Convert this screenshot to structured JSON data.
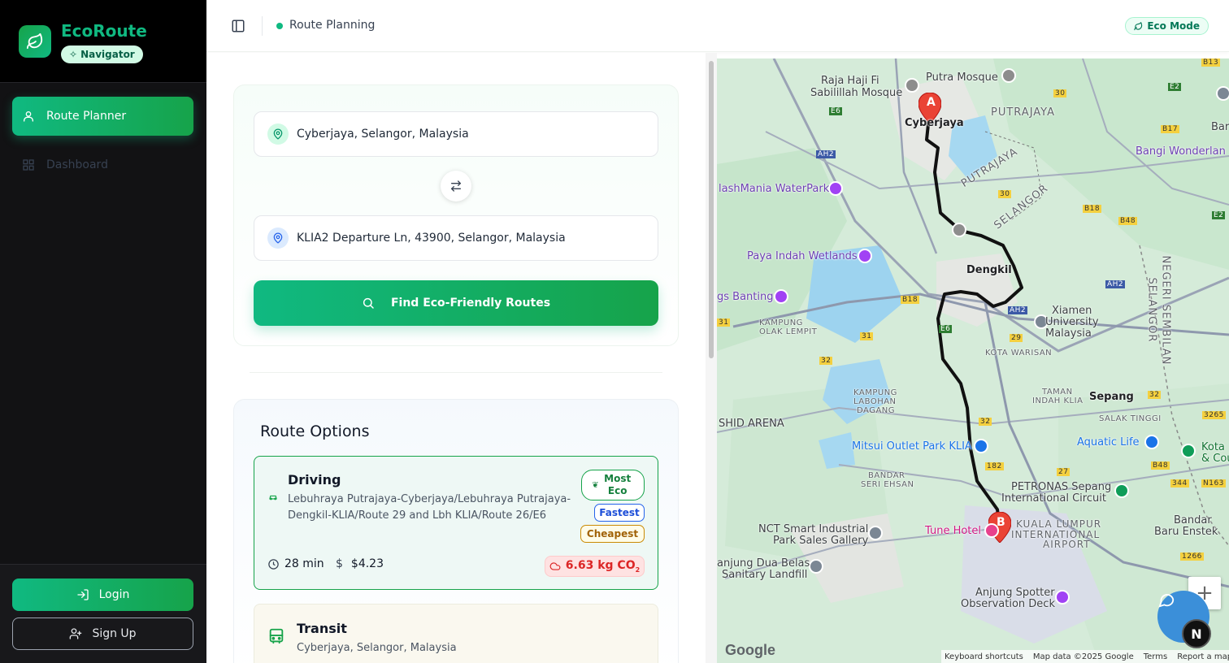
{
  "sidebar": {
    "brand_title": "EcoRoute",
    "brand_badge": "Navigator",
    "nav": [
      {
        "label": "Route Planner",
        "icon": "user-pin-icon",
        "active": true
      },
      {
        "label": "Dashboard",
        "icon": "grid-icon",
        "active": false
      }
    ],
    "login_label": "Login",
    "signup_label": "Sign Up"
  },
  "topbar": {
    "page_label": "Route Planning",
    "eco_mode_label": "Eco Mode"
  },
  "search": {
    "origin": "Cyberjaya, Selangor, Malaysia",
    "destination": "KLIA2 Departure Ln, 43900, Selangor, Malaysia",
    "find_label": "Find Eco-Friendly Routes"
  },
  "routes": {
    "title": "Route Options",
    "items": [
      {
        "mode": "Driving",
        "description": "Lebuhraya Putrajaya-Cyberjaya/Lebuhraya Putrajaya-Dengkil-KLIA/Route 29 and Lbh KLIA/Route 26/E6",
        "tags": [
          "Most Eco",
          "Fastest",
          "Cheapest"
        ],
        "duration": "28 min",
        "cost": "$4.23",
        "co2": "6.63 kg CO",
        "co2_sub": "2"
      },
      {
        "mode": "Transit",
        "description": "Cyberjaya, Selangor, Malaysia"
      }
    ]
  },
  "map": {
    "labels": {
      "raja_haji": "Raja Haji Fi",
      "sabilillah": "Sabilillah Mosque",
      "putra_mosque": "Putra Mosque",
      "cyberjaya": "Cyberjaya",
      "putrajaya": "PUTRAJAYA",
      "putrajaya_area": "PUTRAJAYA",
      "selangor_area": "SELANGOR",
      "bangi": "Bangi Wonderlan",
      "bar": "Bar",
      "splash": "lashMania WaterPark",
      "paya": "Paya Indah Wetlands",
      "dengkil": "Dengkil",
      "banting": "gs Banting",
      "kampung_olak_1": "KAMPUNG",
      "kampung_olak_2": "OLAK LEMPIT",
      "xiamen_1": "Xiamen",
      "xiamen_2": "University",
      "xiamen_3": "Malaysia",
      "kota_warisan": "KOTA WARISAN",
      "negeri_1": "NEGERI SEMBILAN",
      "negeri_2": "SELANGOR",
      "kampung_labohan_1": "KAMPUNG",
      "kampung_labohan_2": "LABOHAN",
      "kampung_labohan_3": "DAGANG",
      "taman_1": "TAMAN",
      "taman_2": "INDAH KLIA",
      "sepang": "Sepang",
      "salak": "SALAK TINGGI",
      "arena": "SHID ARENA",
      "mitsui": "Mitsui Outlet Park KLIA",
      "aquatic": "Aquatic Life",
      "kota_1": "Kota",
      "kota_2": "& Cou",
      "bandar_seri_1": "BANDAR",
      "bandar_seri_2": "SERI EHSAN",
      "petronas_1": "PETRONAS Sepang",
      "petronas_2": "International Circuit",
      "nct_1": "NCT Smart Industrial",
      "nct_2": "Park Sales Gallery",
      "tune": "Tune Hotel",
      "klia_1": "KUALA LUMPUR",
      "klia_2": "INTERNATIONAL",
      "klia_3": "AIRPORT",
      "bandar_baru_1": "Bandar",
      "bandar_baru_2": "Baru Enstek",
      "tanjung_1": "anjung Dua Belas",
      "tanjung_2": "Sanitary Landfill",
      "anjung_1": "Anjung Spotter",
      "anjung_2": "Observation Deck",
      "marker_a": "A",
      "marker_b": "B",
      "shields": {
        "b13": "B13",
        "e2a": "E2",
        "e6": "E6",
        "ah2a": "AH2",
        "n30a": "30",
        "b17": "B17",
        "b18a": "B18",
        "b48": "B48",
        "n30b": "30",
        "e2b": "E2",
        "ah2b": "AH2",
        "ah2c": "AH2",
        "b18b": "B18",
        "n31a": "31",
        "n29": "29",
        "n31b": "31",
        "n32a": "32",
        "n32b": "32",
        "n32c": "32",
        "n182": "182",
        "n27": "27",
        "b48b": "B48",
        "n344": "344",
        "n3265": "3265",
        "n163": "N163",
        "n1266": "1266",
        "e6b": "E6"
      }
    },
    "google": "Google",
    "footer": [
      "Keyboard shortcuts",
      "Map data ©2025 Google",
      "Terms",
      "Report a map error"
    ],
    "zoom_in": "+",
    "avatar_letter": "N"
  },
  "colors": {
    "accent": "#10b981",
    "accent_dark": "#16a34a",
    "sidebar_bg": "#121214",
    "route_line": "#111111",
    "marker": "#ea4335"
  }
}
